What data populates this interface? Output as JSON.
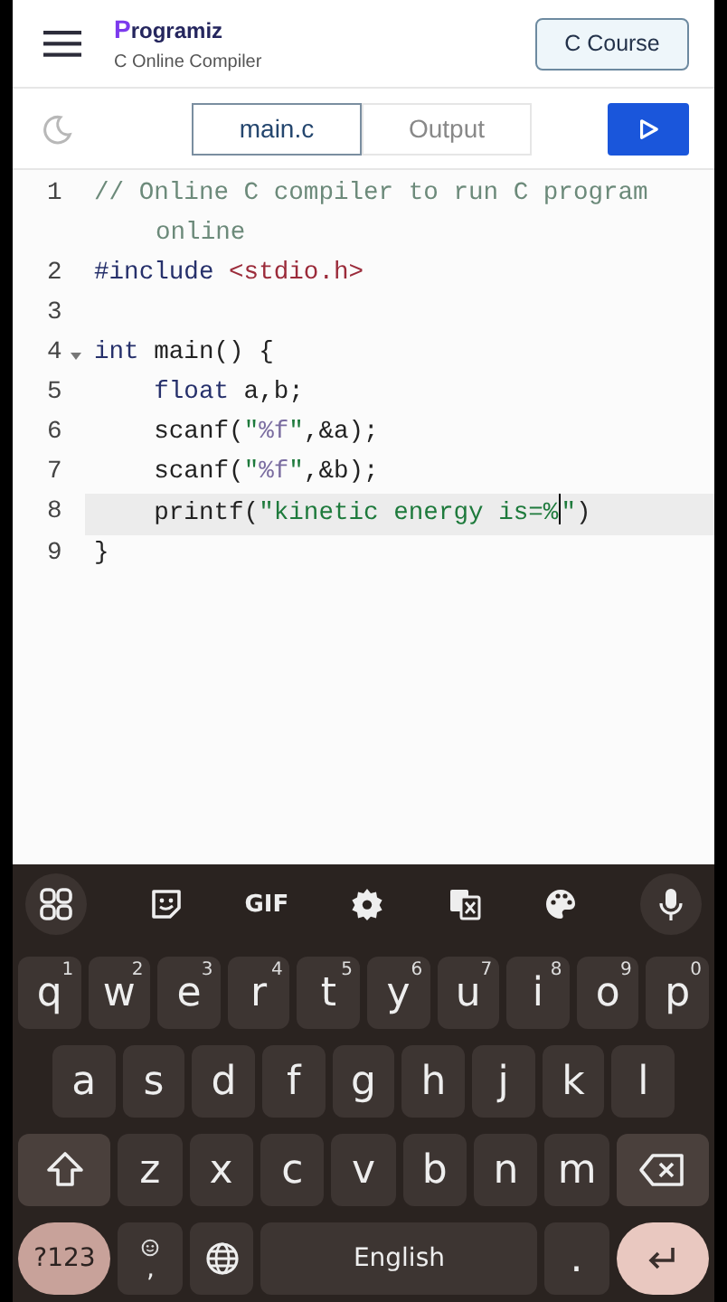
{
  "header": {
    "logo": "Programiz",
    "subtitle": "C Online Compiler",
    "course_button": "C Course"
  },
  "tabs": [
    {
      "label": "main.c",
      "selected": true
    },
    {
      "label": "Output",
      "selected": false
    }
  ],
  "editor": {
    "lines": [
      {
        "number": "1",
        "active": false,
        "tokens": [
          {
            "kind": "comment",
            "text": "// Online C compiler to run C program online"
          }
        ]
      },
      {
        "number": "2",
        "active": false,
        "tokens": [
          {
            "kind": "preprocessor",
            "text": "#include "
          },
          {
            "kind": "header",
            "text": "<stdio.h>"
          }
        ]
      },
      {
        "number": "3",
        "active": false
      },
      {
        "number": "4",
        "foldable": true,
        "active": false,
        "tokens": [
          {
            "kind": "keyword",
            "text": "int"
          },
          {
            "kind": "plain",
            "text": " main() {"
          }
        ]
      },
      {
        "number": "5",
        "active": false,
        "tokens": [
          {
            "kind": "keyword",
            "text": "    float"
          },
          {
            "kind": "plain",
            "text": " a,b;"
          }
        ]
      },
      {
        "number": "6",
        "active": false,
        "tokens": [
          {
            "kind": "plain",
            "text": "    scanf("
          },
          {
            "kind": "string",
            "text": "\""
          },
          {
            "kind": "format",
            "text": "%f"
          },
          {
            "kind": "string",
            "text": "\""
          },
          {
            "kind": "plain",
            "text": ",&a);"
          }
        ]
      },
      {
        "number": "7",
        "active": false,
        "tokens": [
          {
            "kind": "plain",
            "text": "    scanf("
          },
          {
            "kind": "string",
            "text": "\""
          },
          {
            "kind": "format",
            "text": "%f"
          },
          {
            "kind": "string",
            "text": "\""
          },
          {
            "kind": "plain",
            "text": ",&b);"
          }
        ]
      },
      {
        "number": "8",
        "active": true,
        "tokens": [
          {
            "kind": "plain",
            "text": "    printf("
          },
          {
            "kind": "string",
            "text": "\"kinetic energy is=%"
          },
          {
            "kind": "cursor"
          },
          {
            "kind": "string",
            "text": "\""
          },
          {
            "kind": "plain",
            "text": ")"
          }
        ]
      },
      {
        "number": "9",
        "active": false,
        "tokens": [
          {
            "kind": "plain",
            "text": "}"
          }
        ]
      }
    ]
  },
  "keyboard": {
    "toolbar": [
      {
        "kind": "grid"
      },
      {
        "kind": "sticker"
      },
      {
        "kind": "gif",
        "text": "GIF"
      },
      {
        "kind": "settings"
      },
      {
        "kind": "translate"
      },
      {
        "kind": "palette"
      },
      {
        "kind": "mic"
      }
    ],
    "rows": [
      {
        "keys": [
          {
            "kind": "letter",
            "label": "q",
            "hint": "1"
          },
          {
            "kind": "letter",
            "label": "w",
            "hint": "2"
          },
          {
            "kind": "letter",
            "label": "e",
            "hint": "3"
          },
          {
            "kind": "letter",
            "label": "r",
            "hint": "4"
          },
          {
            "kind": "letter",
            "label": "t",
            "hint": "5"
          },
          {
            "kind": "letter",
            "label": "y",
            "hint": "6"
          },
          {
            "kind": "letter",
            "label": "u",
            "hint": "7"
          },
          {
            "kind": "letter",
            "label": "i",
            "hint": "8"
          },
          {
            "kind": "letter",
            "label": "o",
            "hint": "9"
          },
          {
            "kind": "letter",
            "label": "p",
            "hint": "0"
          }
        ]
      },
      {
        "keys": [
          {
            "kind": "letter",
            "label": "a"
          },
          {
            "kind": "letter",
            "label": "s"
          },
          {
            "kind": "letter",
            "label": "d"
          },
          {
            "kind": "letter",
            "label": "f"
          },
          {
            "kind": "letter",
            "label": "g"
          },
          {
            "kind": "letter",
            "label": "h"
          },
          {
            "kind": "letter",
            "label": "j"
          },
          {
            "kind": "letter",
            "label": "k"
          },
          {
            "kind": "letter",
            "label": "l"
          }
        ]
      },
      {
        "keys": [
          {
            "kind": "shift"
          },
          {
            "kind": "letter",
            "label": "z"
          },
          {
            "kind": "letter",
            "label": "x"
          },
          {
            "kind": "letter",
            "label": "c"
          },
          {
            "kind": "letter",
            "label": "v"
          },
          {
            "kind": "letter",
            "label": "b"
          },
          {
            "kind": "letter",
            "label": "n"
          },
          {
            "kind": "letter",
            "label": "m"
          },
          {
            "kind": "backspace"
          }
        ]
      },
      {
        "keys": [
          {
            "kind": "symbols",
            "label": "?123"
          },
          {
            "kind": "emoji",
            "label": ","
          },
          {
            "kind": "globe"
          },
          {
            "kind": "space",
            "label": "English"
          },
          {
            "kind": "letter",
            "label": "."
          },
          {
            "kind": "enter"
          }
        ]
      }
    ]
  }
}
